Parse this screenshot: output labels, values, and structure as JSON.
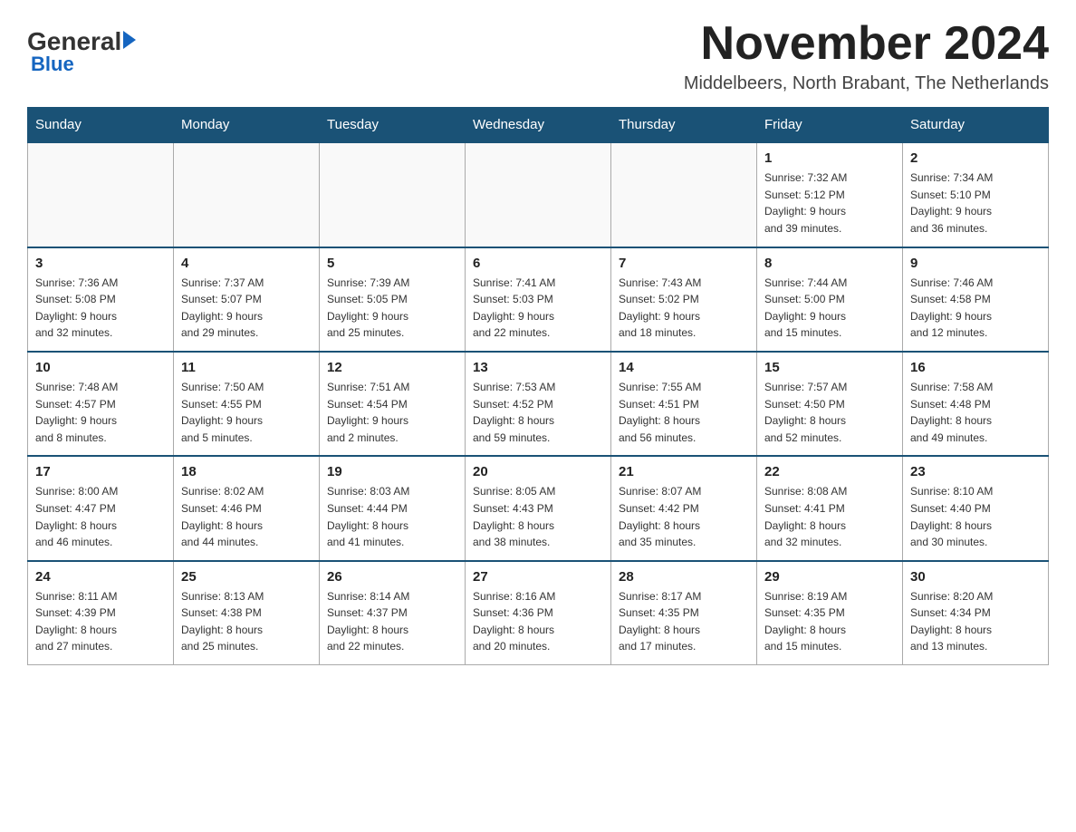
{
  "logo": {
    "general": "General",
    "blue": "Blue",
    "sub": "Blue"
  },
  "title": {
    "month": "November 2024",
    "location": "Middelbeers, North Brabant, The Netherlands"
  },
  "days_of_week": [
    "Sunday",
    "Monday",
    "Tuesday",
    "Wednesday",
    "Thursday",
    "Friday",
    "Saturday"
  ],
  "weeks": [
    [
      {
        "day": "",
        "info": ""
      },
      {
        "day": "",
        "info": ""
      },
      {
        "day": "",
        "info": ""
      },
      {
        "day": "",
        "info": ""
      },
      {
        "day": "",
        "info": ""
      },
      {
        "day": "1",
        "info": "Sunrise: 7:32 AM\nSunset: 5:12 PM\nDaylight: 9 hours\nand 39 minutes."
      },
      {
        "day": "2",
        "info": "Sunrise: 7:34 AM\nSunset: 5:10 PM\nDaylight: 9 hours\nand 36 minutes."
      }
    ],
    [
      {
        "day": "3",
        "info": "Sunrise: 7:36 AM\nSunset: 5:08 PM\nDaylight: 9 hours\nand 32 minutes."
      },
      {
        "day": "4",
        "info": "Sunrise: 7:37 AM\nSunset: 5:07 PM\nDaylight: 9 hours\nand 29 minutes."
      },
      {
        "day": "5",
        "info": "Sunrise: 7:39 AM\nSunset: 5:05 PM\nDaylight: 9 hours\nand 25 minutes."
      },
      {
        "day": "6",
        "info": "Sunrise: 7:41 AM\nSunset: 5:03 PM\nDaylight: 9 hours\nand 22 minutes."
      },
      {
        "day": "7",
        "info": "Sunrise: 7:43 AM\nSunset: 5:02 PM\nDaylight: 9 hours\nand 18 minutes."
      },
      {
        "day": "8",
        "info": "Sunrise: 7:44 AM\nSunset: 5:00 PM\nDaylight: 9 hours\nand 15 minutes."
      },
      {
        "day": "9",
        "info": "Sunrise: 7:46 AM\nSunset: 4:58 PM\nDaylight: 9 hours\nand 12 minutes."
      }
    ],
    [
      {
        "day": "10",
        "info": "Sunrise: 7:48 AM\nSunset: 4:57 PM\nDaylight: 9 hours\nand 8 minutes."
      },
      {
        "day": "11",
        "info": "Sunrise: 7:50 AM\nSunset: 4:55 PM\nDaylight: 9 hours\nand 5 minutes."
      },
      {
        "day": "12",
        "info": "Sunrise: 7:51 AM\nSunset: 4:54 PM\nDaylight: 9 hours\nand 2 minutes."
      },
      {
        "day": "13",
        "info": "Sunrise: 7:53 AM\nSunset: 4:52 PM\nDaylight: 8 hours\nand 59 minutes."
      },
      {
        "day": "14",
        "info": "Sunrise: 7:55 AM\nSunset: 4:51 PM\nDaylight: 8 hours\nand 56 minutes."
      },
      {
        "day": "15",
        "info": "Sunrise: 7:57 AM\nSunset: 4:50 PM\nDaylight: 8 hours\nand 52 minutes."
      },
      {
        "day": "16",
        "info": "Sunrise: 7:58 AM\nSunset: 4:48 PM\nDaylight: 8 hours\nand 49 minutes."
      }
    ],
    [
      {
        "day": "17",
        "info": "Sunrise: 8:00 AM\nSunset: 4:47 PM\nDaylight: 8 hours\nand 46 minutes."
      },
      {
        "day": "18",
        "info": "Sunrise: 8:02 AM\nSunset: 4:46 PM\nDaylight: 8 hours\nand 44 minutes."
      },
      {
        "day": "19",
        "info": "Sunrise: 8:03 AM\nSunset: 4:44 PM\nDaylight: 8 hours\nand 41 minutes."
      },
      {
        "day": "20",
        "info": "Sunrise: 8:05 AM\nSunset: 4:43 PM\nDaylight: 8 hours\nand 38 minutes."
      },
      {
        "day": "21",
        "info": "Sunrise: 8:07 AM\nSunset: 4:42 PM\nDaylight: 8 hours\nand 35 minutes."
      },
      {
        "day": "22",
        "info": "Sunrise: 8:08 AM\nSunset: 4:41 PM\nDaylight: 8 hours\nand 32 minutes."
      },
      {
        "day": "23",
        "info": "Sunrise: 8:10 AM\nSunset: 4:40 PM\nDaylight: 8 hours\nand 30 minutes."
      }
    ],
    [
      {
        "day": "24",
        "info": "Sunrise: 8:11 AM\nSunset: 4:39 PM\nDaylight: 8 hours\nand 27 minutes."
      },
      {
        "day": "25",
        "info": "Sunrise: 8:13 AM\nSunset: 4:38 PM\nDaylight: 8 hours\nand 25 minutes."
      },
      {
        "day": "26",
        "info": "Sunrise: 8:14 AM\nSunset: 4:37 PM\nDaylight: 8 hours\nand 22 minutes."
      },
      {
        "day": "27",
        "info": "Sunrise: 8:16 AM\nSunset: 4:36 PM\nDaylight: 8 hours\nand 20 minutes."
      },
      {
        "day": "28",
        "info": "Sunrise: 8:17 AM\nSunset: 4:35 PM\nDaylight: 8 hours\nand 17 minutes."
      },
      {
        "day": "29",
        "info": "Sunrise: 8:19 AM\nSunset: 4:35 PM\nDaylight: 8 hours\nand 15 minutes."
      },
      {
        "day": "30",
        "info": "Sunrise: 8:20 AM\nSunset: 4:34 PM\nDaylight: 8 hours\nand 13 minutes."
      }
    ]
  ]
}
